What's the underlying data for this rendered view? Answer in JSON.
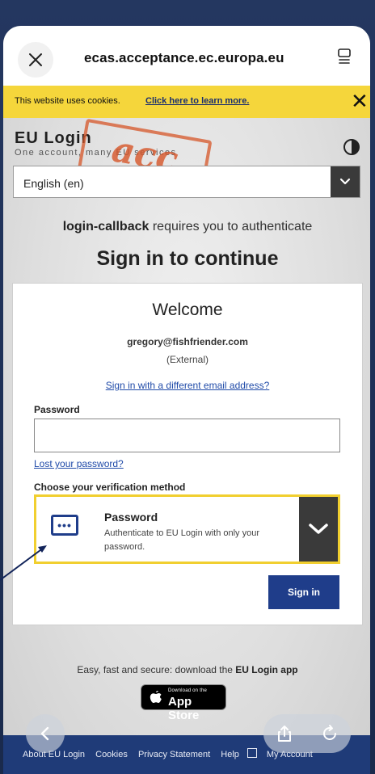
{
  "browser": {
    "url": "ecas.acceptance.ec.europa.eu"
  },
  "cookie_banner": {
    "text": "This website uses cookies.",
    "link": "Click here to learn more.",
    "close": "✕"
  },
  "header": {
    "title": "EU Login",
    "subtitle": "One account, many EU services",
    "stamp": "acc"
  },
  "language": {
    "selected": "English (en)"
  },
  "auth": {
    "service": "login-callback",
    "requires": " requires you to authenticate",
    "heading": "Sign in to continue"
  },
  "card": {
    "welcome": "Welcome",
    "email": "gregory@fishfriender.com",
    "account_type": "(External)",
    "different_email": "Sign in with a different email address?",
    "password_label": "Password",
    "password_value": "",
    "lost_password": "Lost your password?",
    "verification_label": "Choose your verification method",
    "method_title": "Password",
    "method_desc": "Authenticate to EU Login with only your password.",
    "method_icon": "•••",
    "signin": "Sign in"
  },
  "app_promo": {
    "text": "Easy, fast and secure: download the ",
    "app_name": "EU Login app",
    "store_small": "Download on the",
    "store_big": "App Store"
  },
  "footer": {
    "about": "About EU Login",
    "cookies": "Cookies",
    "privacy": "Privacy Statement",
    "help": "Help",
    "account": "My Account"
  },
  "colors": {
    "cookie_bar": "#f5d63b",
    "primary": "#1f3d8a",
    "footer": "#1f3b78",
    "method_border": "#f1cf2f"
  }
}
